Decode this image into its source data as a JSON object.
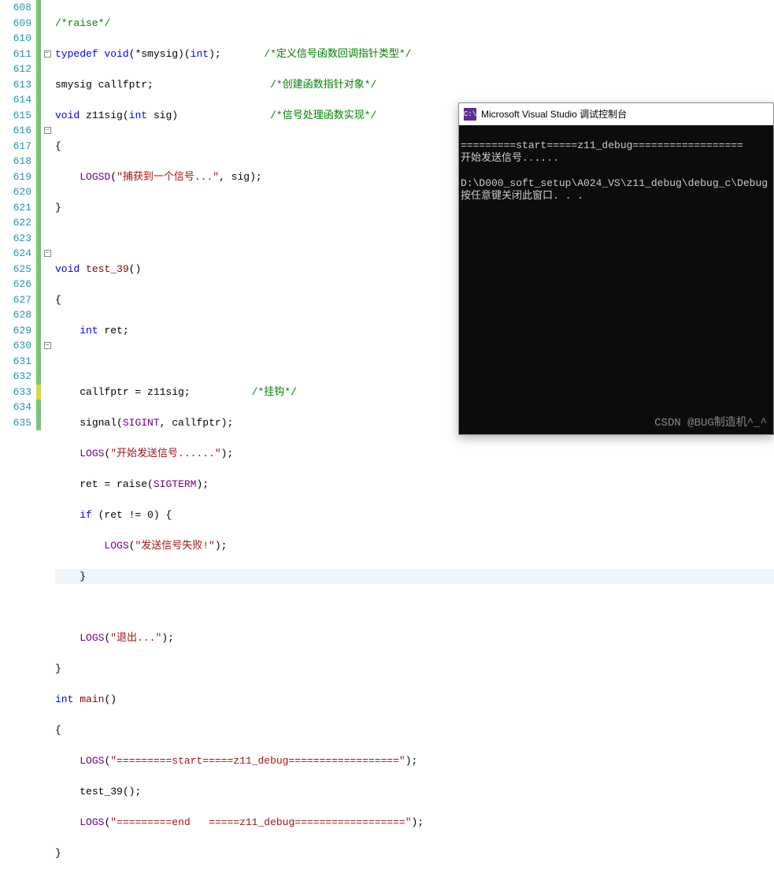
{
  "lines": {
    "start": 608,
    "end": 635
  },
  "code": {
    "l608": {
      "cmt": "/*raise*/"
    },
    "l609": {
      "kw1": "typedef",
      "kw2": "void",
      "id": "(*smysig)(",
      "kw3": "int",
      "tail": ");",
      "cmt": "/*定义信号函数回调指针类型*/"
    },
    "l610": {
      "t": "smysig callfptr;",
      "cmt": "/*创建函数指针对象*/"
    },
    "l611": {
      "kw": "void",
      "fn": "z11sig",
      "sig": "(",
      "kw2": "int",
      "sig2": " sig)",
      "cmt": "/*信号处理函数实现*/"
    },
    "l612": {
      "t": "{"
    },
    "l613": {
      "mac": "LOGSD",
      "open": "(",
      "str": "\"捕获到一个信号...\"",
      "rest": ", sig);"
    },
    "l614": {
      "t": "}"
    },
    "l615": {
      "t": ""
    },
    "l616": {
      "kw": "void",
      "fn": "test_39",
      "sig": "()"
    },
    "l617": {
      "t": "{"
    },
    "l618": {
      "kw": "int",
      "rest": " ret;"
    },
    "l619": {
      "t": ""
    },
    "l620": {
      "t": "callfptr = z11sig;",
      "cmt": "/*挂钩*/"
    },
    "l621": {
      "fn": "signal",
      "open": "(",
      "c1": "SIGINT",
      "rest": ", callfptr);"
    },
    "l622": {
      "mac": "LOGS",
      "open": "(",
      "str": "\"开始发送信号......\"",
      "rest": ");"
    },
    "l623": {
      "t": "ret = ",
      "fn": "raise",
      "open": "(",
      "c1": "SIGTERM",
      "rest": ");"
    },
    "l624": {
      "kw": "if",
      "rest": " (ret != 0) {"
    },
    "l625": {
      "mac": "LOGS",
      "open": "(",
      "str": "\"发送信号失败!\"",
      "rest": ");"
    },
    "l626": {
      "t": "}"
    },
    "l627": {
      "t": ""
    },
    "l628": {
      "mac": "LOGS",
      "open": "(",
      "str": "\"退出...\"",
      "rest": ");"
    },
    "l629": {
      "t": "}"
    },
    "l630": {
      "kw": "int",
      "fn": "main",
      "sig": "()"
    },
    "l631": {
      "t": "{"
    },
    "l632": {
      "mac": "LOGS",
      "open": "(",
      "str": "\"=========start=====z11_debug==================\"",
      "rest": ");"
    },
    "l633": {
      "fn": "test_39",
      "rest": "();"
    },
    "l634": {
      "mac": "LOGS",
      "open": "(",
      "str": "\"=========end   =====z11_debug==================\"",
      "rest": ");"
    },
    "l635": {
      "t": "}"
    }
  },
  "console": {
    "title": "Microsoft Visual Studio 调试控制台",
    "icon": "C:\\",
    "lines": [
      "=========start=====z11_debug==================",
      "开始发送信号......",
      "",
      "D:\\D000_soft_setup\\A024_VS\\z11_debug\\debug_c\\Debug",
      "按任意键关闭此窗口. . ."
    ]
  },
  "watermark": "CSDN @BUG制造机^_^"
}
